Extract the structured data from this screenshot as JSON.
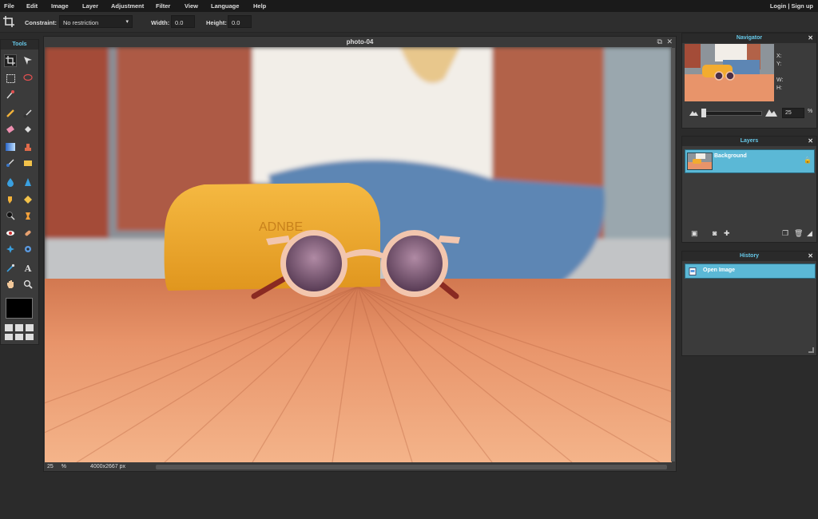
{
  "menubar": {
    "items": [
      "File",
      "Edit",
      "Image",
      "Layer",
      "Adjustment",
      "Filter",
      "View",
      "Language",
      "Help"
    ],
    "auth": "Login | Sign up"
  },
  "options": {
    "constraint_label": "Constraint:",
    "constraint_value": "No restriction",
    "width_label": "Width:",
    "width_value": "0.0",
    "height_label": "Height:",
    "height_value": "0.0"
  },
  "tools": {
    "title": "Tools"
  },
  "document": {
    "title": "photo-04",
    "zoom": "25",
    "zoom_unit": "%",
    "image_size": "4000x2667 px",
    "canvas_text": "ADNBE"
  },
  "navigator": {
    "title": "Navigator",
    "x_label": "X:",
    "y_label": "Y:",
    "w_label": "W:",
    "h_label": "H:",
    "zoom_value": "25",
    "zoom_unit": "%"
  },
  "layers": {
    "title": "Layers",
    "items": [
      {
        "name": "Background"
      }
    ]
  },
  "history": {
    "title": "History",
    "items": [
      {
        "name": "Open Image"
      }
    ]
  },
  "colors": {
    "accent": "#5bb8d6",
    "panel_title": "#66c8e8",
    "background": "#2b2b2b"
  }
}
